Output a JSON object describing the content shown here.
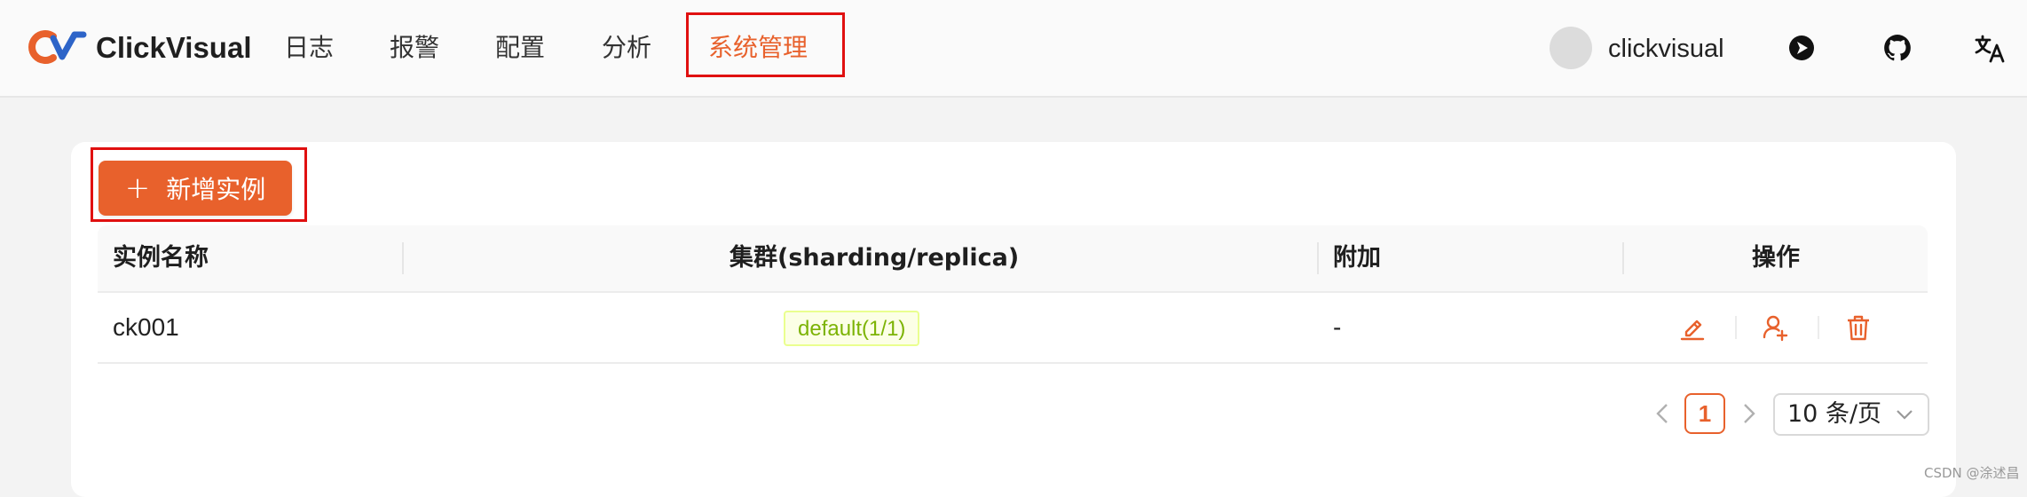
{
  "app": {
    "brand": "ClickVisual",
    "nav": [
      "日志",
      "报警",
      "配置",
      "分析",
      "系统管理"
    ],
    "active_nav": "系统管理",
    "username": "clickvisual",
    "accent_color": "#e8612c"
  },
  "toolbar": {
    "add_button_label": "新增实例",
    "add_button_icon": "plus-icon"
  },
  "table": {
    "columns": [
      "实例名称",
      "集群(sharding/replica)",
      "附加",
      "操作"
    ],
    "rows": [
      {
        "name": "ck001",
        "cluster": "default(1/1)",
        "extra": "-",
        "actions": [
          "edit-icon",
          "user-add-icon",
          "delete-icon"
        ]
      }
    ]
  },
  "pagination": {
    "current_page": "1",
    "page_size": "10 条/页"
  },
  "watermark": "CSDN @涂述昌"
}
